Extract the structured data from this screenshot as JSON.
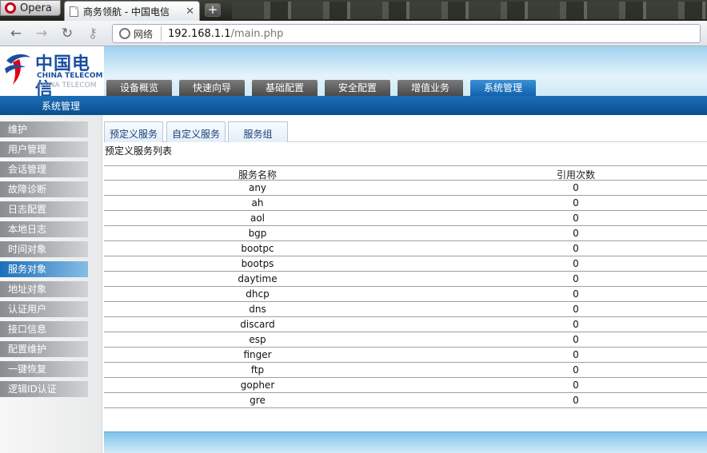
{
  "browser": {
    "menu_label": "Opera",
    "tab_title": "商务领航 - 中国电信",
    "tab_close": "✕",
    "new_tab": "+",
    "net_label": "网络",
    "url_host": "192.168.1.1",
    "url_path": "/main.php"
  },
  "logo": {
    "cn": "中国电信",
    "en": "CHINA TELECOM",
    "en_reflection": "CHINA TELECOM"
  },
  "main_nav": [
    {
      "label": "设备概览"
    },
    {
      "label": "快速向导"
    },
    {
      "label": "基础配置"
    },
    {
      "label": "安全配置"
    },
    {
      "label": "增值业务"
    },
    {
      "label": "系统管理",
      "active": true
    }
  ],
  "section_title": "系统管理",
  "sidebar": [
    {
      "label": "维护"
    },
    {
      "label": "用户管理"
    },
    {
      "label": "会话管理"
    },
    {
      "label": "故障诊断"
    },
    {
      "label": "日志配置"
    },
    {
      "label": "本地日志"
    },
    {
      "label": "时间对象"
    },
    {
      "label": "服务对象",
      "active": true
    },
    {
      "label": "地址对象"
    },
    {
      "label": "认证用户"
    },
    {
      "label": "接口信息"
    },
    {
      "label": "配置维护"
    },
    {
      "label": "一键恢复"
    },
    {
      "label": "逻辑ID认证"
    }
  ],
  "content_tabs": [
    {
      "label": "预定义服务",
      "active": true
    },
    {
      "label": "自定义服务"
    },
    {
      "label": "服务组"
    }
  ],
  "list_caption": "预定义服务列表",
  "table": {
    "columns": [
      "服务名称",
      "引用次数"
    ],
    "rows": [
      [
        "any",
        "0"
      ],
      [
        "ah",
        "0"
      ],
      [
        "aol",
        "0"
      ],
      [
        "bgp",
        "0"
      ],
      [
        "bootpc",
        "0"
      ],
      [
        "bootps",
        "0"
      ],
      [
        "daytime",
        "0"
      ],
      [
        "dhcp",
        "0"
      ],
      [
        "dns",
        "0"
      ],
      [
        "discard",
        "0"
      ],
      [
        "esp",
        "0"
      ],
      [
        "finger",
        "0"
      ],
      [
        "ftp",
        "0"
      ],
      [
        "gopher",
        "0"
      ],
      [
        "gre",
        "0"
      ]
    ]
  },
  "colors": {
    "accent": "#1263ad",
    "sidebar_active": "#1c6fb9",
    "logo_blue": "#1a4fa0"
  }
}
